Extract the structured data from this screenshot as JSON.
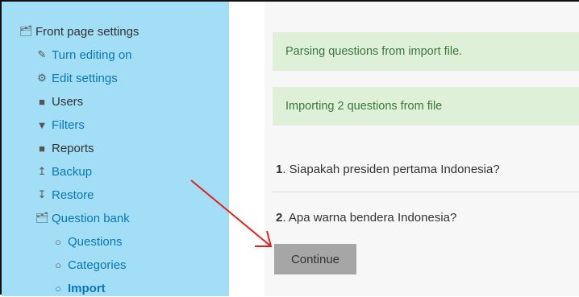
{
  "sidebar": {
    "items": [
      {
        "label": "Front page settings",
        "icon": "folder-open-icon"
      },
      {
        "label": "Turn editing on",
        "icon": "pencil-icon"
      },
      {
        "label": "Edit settings",
        "icon": "gear-icon"
      },
      {
        "label": "Users",
        "icon": "folder-icon"
      },
      {
        "label": "Filters",
        "icon": "filter-icon"
      },
      {
        "label": "Reports",
        "icon": "folder-icon"
      },
      {
        "label": "Backup",
        "icon": "upload-icon"
      },
      {
        "label": "Restore",
        "icon": "download-icon"
      },
      {
        "label": "Question bank",
        "icon": "folder-open-icon"
      },
      {
        "label": "Questions",
        "icon": "circle-icon"
      },
      {
        "label": "Categories",
        "icon": "circle-icon"
      },
      {
        "label": "Import",
        "icon": "circle-icon"
      }
    ]
  },
  "main": {
    "alerts": [
      "Parsing questions from import file.",
      "Importing 2 questions from file"
    ],
    "questions": [
      {
        "number": "1",
        "text": ". Siapakah presiden pertama Indonesia?"
      },
      {
        "number": "2",
        "text": ". Apa warna bendera Indonesia?"
      }
    ],
    "continue_label": "Continue"
  },
  "colors": {
    "sidebar_bg": "#a3def7",
    "link": "#0a77b5",
    "alert_bg": "#dff0d8",
    "alert_text": "#3c763d",
    "button_bg": "#a6a6a6",
    "arrow": "#e32119"
  }
}
